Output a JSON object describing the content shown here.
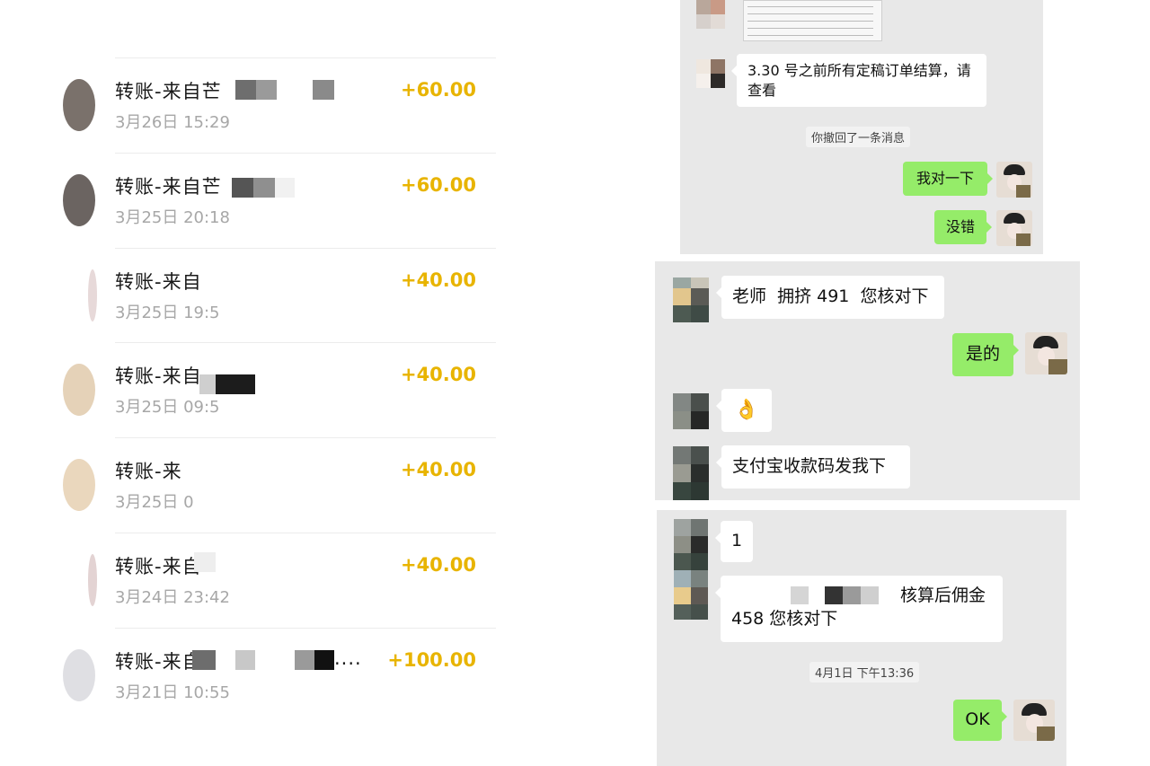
{
  "transactions": [
    {
      "title": "转账-来自芒",
      "date": "3月26日 15:29",
      "amount": "+60.00"
    },
    {
      "title": "转账-来自芒",
      "date": "3月25日 20:18",
      "amount": "+60.00"
    },
    {
      "title": "转账-来自",
      "date": "3月25日 19:5",
      "amount": "+40.00"
    },
    {
      "title": "转账-来自",
      "date": "3月25日 09:5",
      "amount": "+40.00"
    },
    {
      "title": "转账-来",
      "date": "3月25日 0",
      "amount": "+40.00"
    },
    {
      "title": "转账-来自",
      "date": "3月24日 23:42",
      "amount": "+40.00"
    },
    {
      "title": "转账-来自",
      "title_suffix": "....",
      "date": "3月21日 10:55",
      "amount": "+100.00"
    }
  ],
  "chat1": {
    "msg_settlement": "3.30 号之前所有定稿订单结算，请查看",
    "recalled": "你撤回了一条消息",
    "reply_check": "我对一下",
    "reply_correct": "没错"
  },
  "chat2": {
    "msg_teacher": "老师  拥挤 491  您核对下",
    "reply_yes": "是的",
    "emoji": "👌",
    "msg_alipay": "支付宝收款码发我下"
  },
  "chat3": {
    "msg_one": "1",
    "msg_commission_part1": "核算后佣金",
    "msg_commission_part2": "458 您核对下",
    "timestamp": "4月1日 下午13:36",
    "reply_ok": "OK"
  },
  "colors": {
    "amount": "#e8b400",
    "green_bubble": "#95ec69",
    "chat_bg": "#e8e8e8"
  }
}
